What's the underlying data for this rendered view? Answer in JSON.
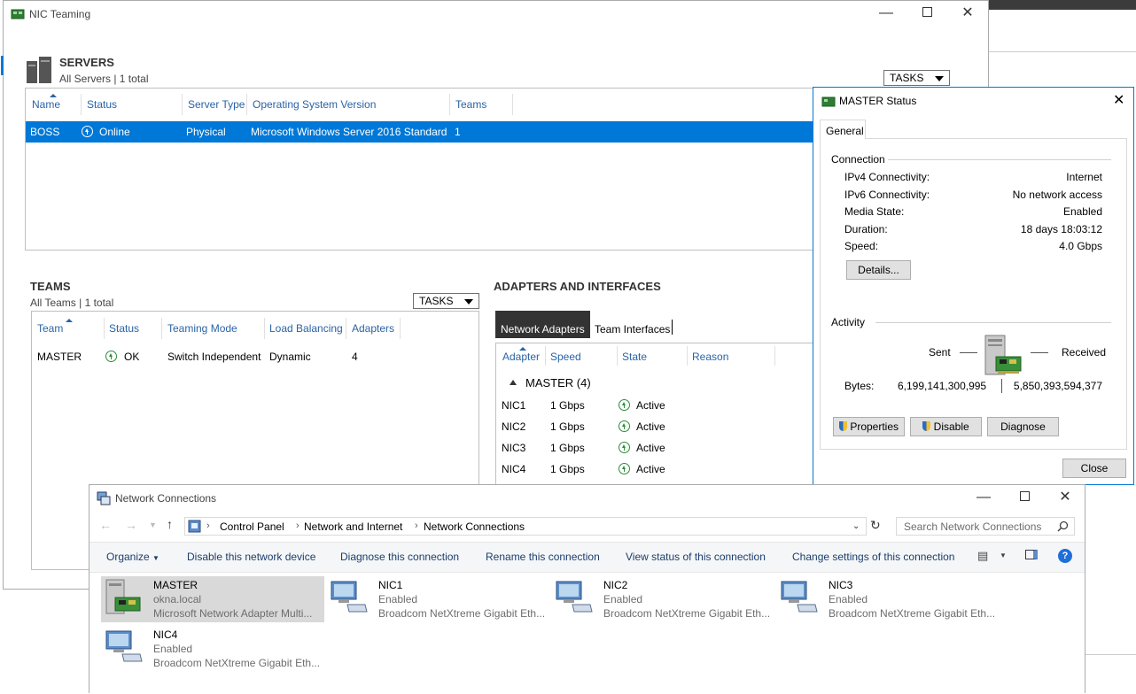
{
  "nic_window": {
    "title": "NIC Teaming",
    "servers": {
      "heading": "SERVERS",
      "subtitle": "All Servers | 1 total",
      "tasks_label": "TASKS",
      "columns": [
        "Name",
        "Status",
        "Server Type",
        "Operating System Version",
        "Teams"
      ],
      "row": {
        "name": "BOSS",
        "status": "Online",
        "type": "Physical",
        "os": "Microsoft Windows Server 2016 Standard",
        "teams": "1"
      }
    },
    "teams": {
      "heading": "TEAMS",
      "subtitle": "All Teams | 1 total",
      "tasks_label": "TASKS",
      "columns": [
        "Team",
        "Status",
        "Teaming Mode",
        "Load Balancing",
        "Adapters"
      ],
      "row": {
        "team": "MASTER",
        "status": "OK",
        "mode": "Switch Independent",
        "lb": "Dynamic",
        "adapters": "4"
      }
    },
    "adapters": {
      "heading": "ADAPTERS AND INTERFACES",
      "tab_active": "Network Adapters",
      "tab_inactive": "Team Interfaces",
      "columns": [
        "Adapter",
        "Speed",
        "State",
        "Reason"
      ],
      "group": "MASTER (4)",
      "rows": [
        {
          "name": "NIC1",
          "speed": "1 Gbps",
          "state": "Active"
        },
        {
          "name": "NIC2",
          "speed": "1 Gbps",
          "state": "Active"
        },
        {
          "name": "NIC3",
          "speed": "1 Gbps",
          "state": "Active"
        },
        {
          "name": "NIC4",
          "speed": "1 Gbps",
          "state": "Active"
        }
      ]
    }
  },
  "status_dialog": {
    "title": "MASTER Status",
    "tab": "General",
    "connection_label": "Connection",
    "fields": [
      {
        "label": "IPv4 Connectivity:",
        "value": "Internet"
      },
      {
        "label": "IPv6 Connectivity:",
        "value": "No network access"
      },
      {
        "label": "Media State:",
        "value": "Enabled"
      },
      {
        "label": "Duration:",
        "value": "18 days 18:03:12"
      },
      {
        "label": "Speed:",
        "value": "4.0 Gbps"
      }
    ],
    "details_button": "Details...",
    "activity_label": "Activity",
    "sent_label": "Sent",
    "received_label": "Received",
    "bytes_label": "Bytes:",
    "bytes_sent": "6,199,141,300,995",
    "bytes_received": "5,850,393,594,377",
    "properties_button": "Properties",
    "disable_button": "Disable",
    "diagnose_button": "Diagnose",
    "close_button": "Close"
  },
  "netconn_window": {
    "title": "Network Connections",
    "breadcrumb": [
      "Control Panel",
      "Network and Internet",
      "Network Connections"
    ],
    "search_placeholder": "Search Network Connections",
    "commands": {
      "organize": "Organize",
      "disable": "Disable this network device",
      "diagnose": "Diagnose this connection",
      "rename": "Rename this connection",
      "view_status": "View status of this connection",
      "change_settings": "Change settings of this connection"
    },
    "items": [
      {
        "name": "MASTER",
        "line2": "okna.local",
        "line3": "Microsoft Network Adapter Multi..."
      },
      {
        "name": "NIC1",
        "line2": "Enabled",
        "line3": "Broadcom NetXtreme Gigabit Eth..."
      },
      {
        "name": "NIC2",
        "line2": "Enabled",
        "line3": "Broadcom NetXtreme Gigabit Eth..."
      },
      {
        "name": "NIC3",
        "line2": "Enabled",
        "line3": "Broadcom NetXtreme Gigabit Eth..."
      },
      {
        "name": "NIC4",
        "line2": "Enabled",
        "line3": "Broadcom NetXtreme Gigabit Eth..."
      }
    ]
  },
  "colors": {
    "selection": "#0078d7",
    "link": "#2a63a6",
    "ok_green": "#2e8b3a"
  }
}
